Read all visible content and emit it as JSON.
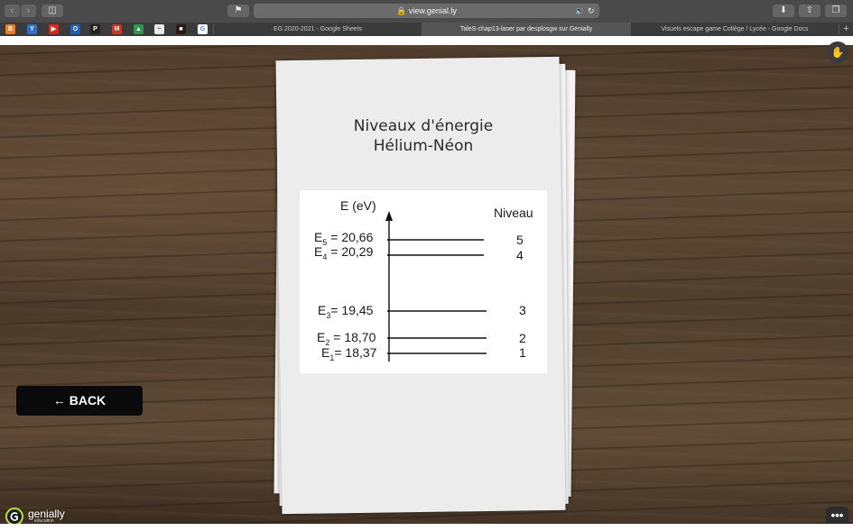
{
  "browser": {
    "url": "view.genial.ly",
    "favicons": [
      "B",
      "Y",
      "▶",
      "O",
      "P",
      "M",
      "▲",
      "~",
      "■",
      "G"
    ],
    "tabs": [
      {
        "label": "EG 2020-2021 - Google Sheets",
        "active": false
      },
      {
        "label": "TaleS-chap13-laser par desplosgw sur Genially",
        "active": true
      },
      {
        "label": "Visuels escape game Collège / Lycée - Google Docs",
        "active": false
      }
    ]
  },
  "card": {
    "title_line1": "Niveaux d'énergie",
    "title_line2": "Hélium-Néon"
  },
  "diagram": {
    "axis_label": "E (eV)",
    "level_header": "Niveau",
    "levels": [
      {
        "symbol": "E",
        "sub": "5",
        "eq": " = 20,66",
        "level": "5"
      },
      {
        "symbol": "E",
        "sub": "4",
        "eq": " = 20,29",
        "level": "4"
      },
      {
        "symbol": "E",
        "sub": "3",
        "eq": "= 19,45",
        "level": "3"
      },
      {
        "symbol": "E",
        "sub": "2",
        "eq": " = 18,70",
        "level": "2"
      },
      {
        "symbol": "E",
        "sub": "1",
        "eq": "= 18,37",
        "level": "1"
      }
    ]
  },
  "controls": {
    "back_label": "BACK",
    "back_arrow": "←",
    "more_label": "•••",
    "corner_icon": "✋"
  },
  "brand": {
    "name": "genially",
    "tagline": "education",
    "accent": "#b4e233"
  },
  "colors": {
    "tab_active_bg": "#555555",
    "toolbar_bg": "#4a4a4a",
    "back_bg": "#0a0a0a"
  }
}
